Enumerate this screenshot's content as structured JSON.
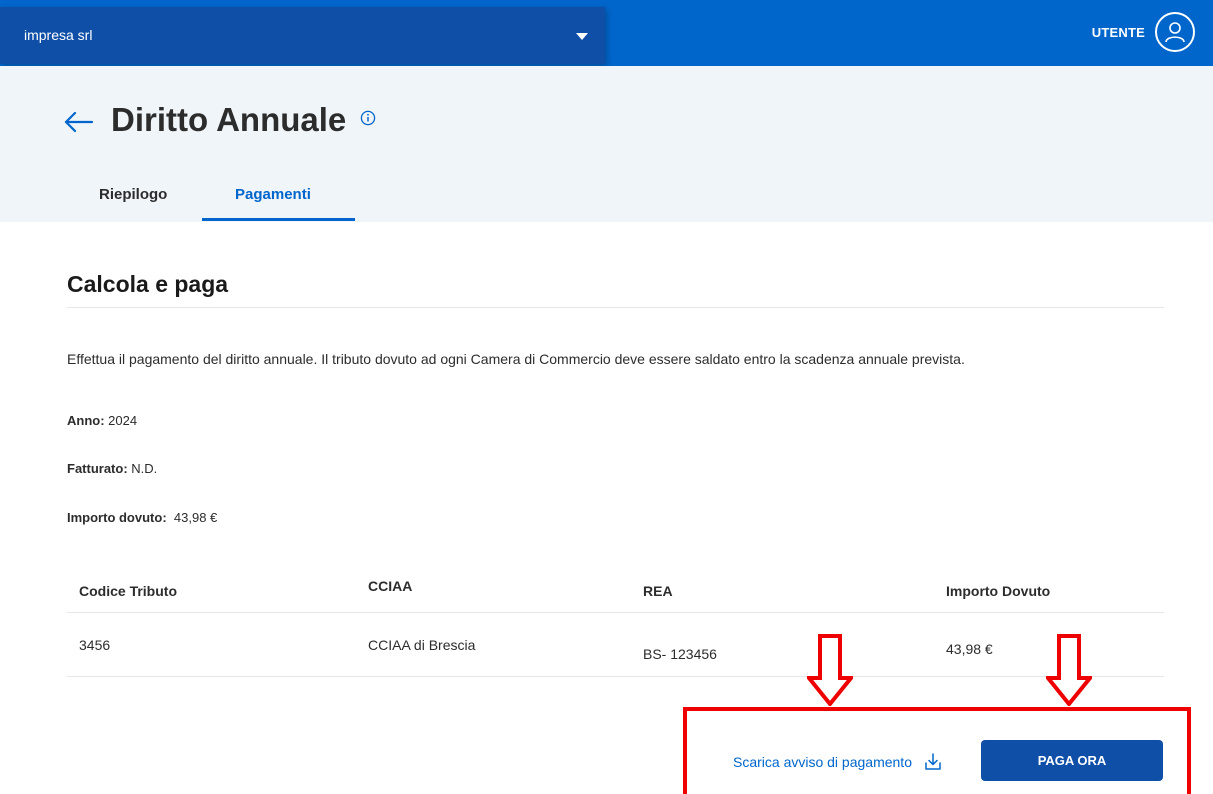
{
  "topbar": {
    "company_name": "impresa srl",
    "user_label": "UTENTE"
  },
  "header": {
    "title": "Diritto Annuale",
    "tabs": [
      {
        "label": "Riepilogo",
        "active": false
      },
      {
        "label": "Pagamenti",
        "active": true
      }
    ]
  },
  "main": {
    "section_title": "Calcola e paga",
    "description": "Effettua il pagamento del diritto annuale. Il tributo dovuto ad ogni Camera di Commercio deve essere saldato entro la scadenza annuale prevista.",
    "info": {
      "anno_label": "Anno:",
      "anno_value": "2024",
      "fatturato_label": "Fatturato:",
      "fatturato_value": "N.D.",
      "importo_label": "Importo dovuto:",
      "importo_value": "43,98 €"
    },
    "table": {
      "headers": [
        "Codice Tributo",
        "CCIAA",
        "REA",
        "Importo Dovuto"
      ],
      "rows": [
        [
          "3456",
          "CCIAA di Brescia",
          "BS- 123456",
          "43,98 €"
        ]
      ]
    },
    "actions": {
      "download_label": "Scarica avviso di pagamento",
      "pay_label": "PAGA ORA"
    }
  },
  "colors": {
    "primary": "#0066cc",
    "primary_dark": "#0f4fa8",
    "header_bg": "#f0f5fa",
    "highlight": "#ee0000"
  }
}
